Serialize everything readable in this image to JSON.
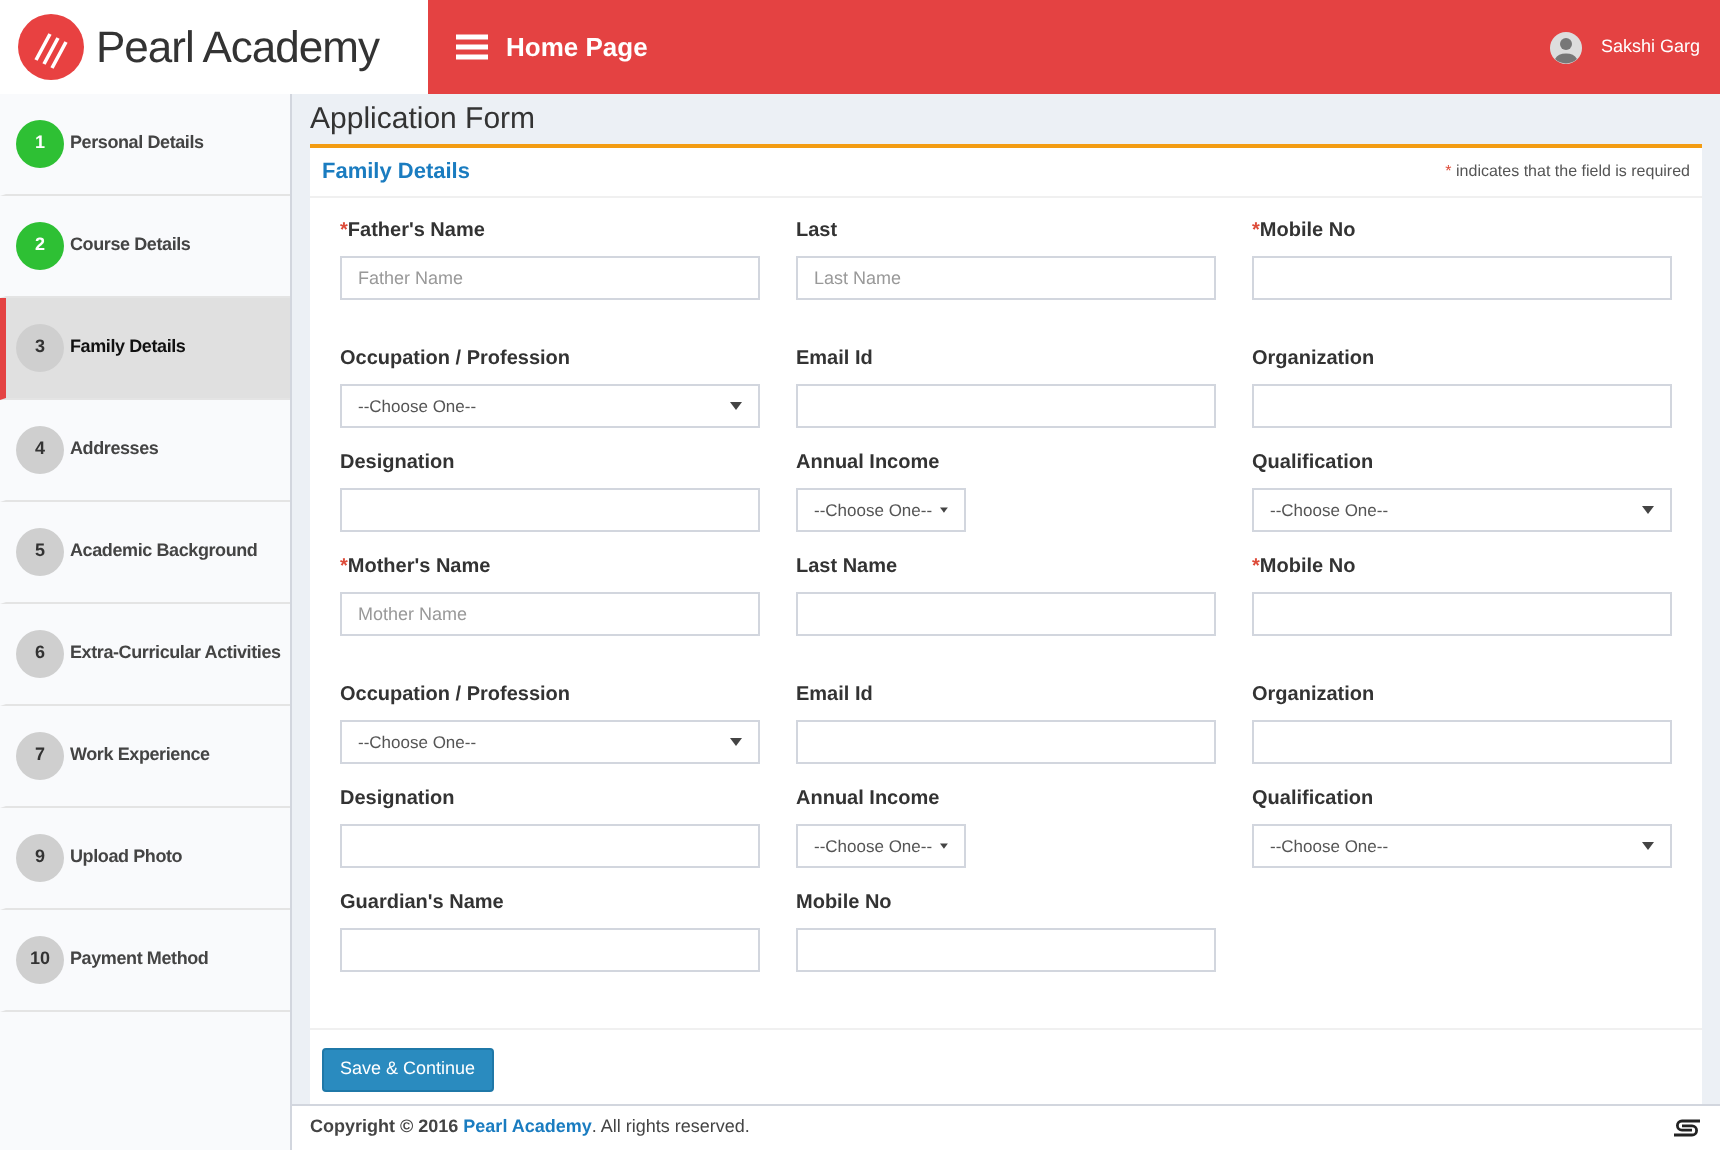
{
  "header": {
    "brand": "Pearl Academy",
    "page_title": "Home Page",
    "user": "Sakshi Garg"
  },
  "sidebar": {
    "items": [
      {
        "number": "1",
        "label": "Personal Details",
        "completed": true,
        "selected": false
      },
      {
        "number": "2",
        "label": "Course Details",
        "completed": true,
        "selected": false
      },
      {
        "number": "3",
        "label": "Family Details",
        "completed": false,
        "selected": true
      },
      {
        "number": "4",
        "label": "Addresses",
        "completed": false,
        "selected": false
      },
      {
        "number": "5",
        "label": "Academic Background",
        "completed": false,
        "selected": false
      },
      {
        "number": "6",
        "label": "Extra-Curricular Activities",
        "completed": false,
        "selected": false
      },
      {
        "number": "7",
        "label": "Work Experience",
        "completed": false,
        "selected": false
      },
      {
        "number": "9",
        "label": "Upload Photo",
        "completed": false,
        "selected": false
      },
      {
        "number": "10",
        "label": "Payment Method",
        "completed": false,
        "selected": false
      }
    ]
  },
  "page_title": "Application Form",
  "card": {
    "title": "Family Details",
    "required_mark": "*",
    "required_note": "indicates that the field is required",
    "rows": [
      [
        {
          "kind": "text",
          "label": "Father's Name",
          "required": true,
          "placeholder": "Father Name"
        },
        {
          "kind": "text",
          "label": "Last",
          "required": false,
          "placeholder": "Last Name"
        },
        {
          "kind": "text",
          "label": "Mobile No",
          "required": true
        }
      ],
      [
        {
          "kind": "select",
          "label": "Occupation / Profession",
          "required": false,
          "value": "--Choose One--"
        },
        {
          "kind": "text",
          "label": "Email Id",
          "required": false
        },
        {
          "kind": "text",
          "label": "Organization",
          "required": false
        }
      ],
      [
        {
          "kind": "text",
          "label": "Designation",
          "required": false
        },
        {
          "kind": "short-select",
          "label": "Annual Income",
          "required": false,
          "value": "--Choose One--"
        },
        {
          "kind": "select",
          "label": "Qualification",
          "required": false,
          "value": "--Choose One--"
        }
      ],
      [
        {
          "kind": "text",
          "label": "Mother's Name",
          "required": true,
          "placeholder": "Mother Name"
        },
        {
          "kind": "text",
          "label": "Last Name",
          "required": false
        },
        {
          "kind": "text",
          "label": "Mobile No",
          "required": true
        }
      ],
      [
        {
          "kind": "select",
          "label": "Occupation / Profession",
          "required": false,
          "value": "--Choose One--"
        },
        {
          "kind": "text",
          "label": "Email Id",
          "required": false
        },
        {
          "kind": "text",
          "label": "Organization",
          "required": false
        }
      ],
      [
        {
          "kind": "text",
          "label": "Designation",
          "required": false
        },
        {
          "kind": "short-select",
          "label": "Annual Income",
          "required": false,
          "value": "--Choose One--"
        },
        {
          "kind": "select",
          "label": "Qualification",
          "required": false,
          "value": "--Choose One--"
        }
      ],
      [
        {
          "kind": "text",
          "label": "Guardian's Name",
          "required": false
        },
        {
          "kind": "text",
          "label": "Mobile No",
          "required": false
        }
      ]
    ],
    "button": "Save & Continue"
  },
  "footer": {
    "prefix": "Copyright © 2016",
    "link": "Pearl Academy",
    "suffix": ". All rights reserved."
  }
}
